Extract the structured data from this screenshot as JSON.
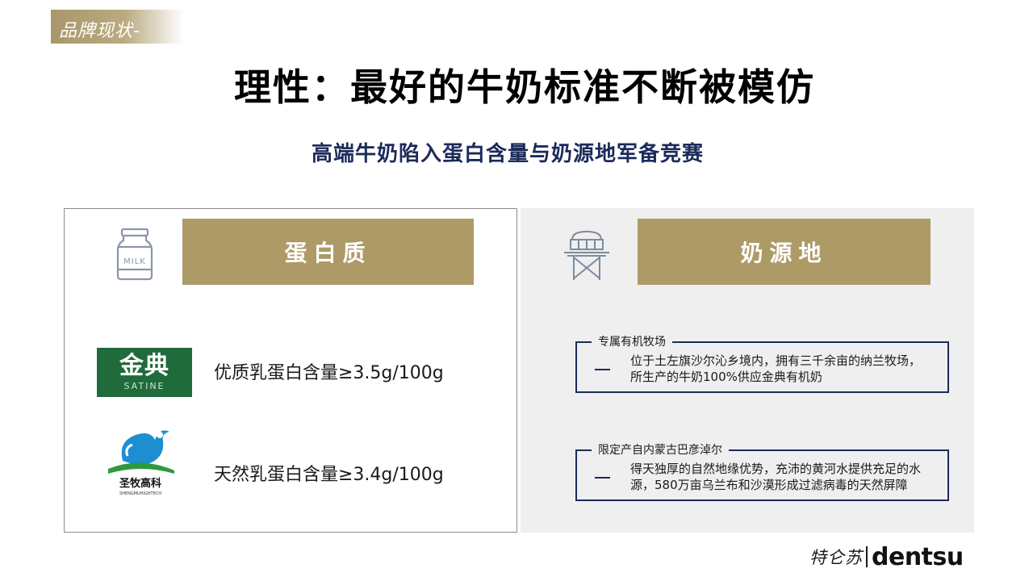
{
  "header": {
    "section_tag": "品牌现状-",
    "title": "理性：最好的牛奶标准不断被模仿",
    "subtitle": "高端牛奶陷入蛋白含量与奶源地军备竞赛"
  },
  "left_panel": {
    "icon_name": "milk-bottle-icon",
    "icon_text": "MILK",
    "header": "蛋白质",
    "brands": [
      {
        "logo_cn": "金典",
        "logo_en": "SATINE",
        "logo_color": "#1f6b3b",
        "text": "优质乳蛋白含量≥3.5g/100g"
      },
      {
        "logo_cn": "圣牧高科",
        "logo_en": "SHENGMUHIGHTECH",
        "text": "天然乳蛋白含量≥3.4g/100g"
      }
    ]
  },
  "right_panel": {
    "icon_name": "watchtower-icon",
    "header": "奶源地",
    "boxes": [
      {
        "label": "专属有机牧场",
        "text": "位于土左旗沙尔沁乡境内，拥有三千余亩的纳兰牧场，所生产的牛奶100%供应金典有机奶"
      },
      {
        "label": "限定产自内蒙古巴彦淖尔",
        "text": "得天独厚的自然地缘优势，充沛的黄河水提供充足的水源，580万亩乌兰布和沙漠形成过滤病毒的天然屏障"
      }
    ]
  },
  "footer": {
    "logo_left": "特仑苏",
    "logo_right": "dentsu"
  },
  "colors": {
    "gold": "#ad9a67",
    "navy": "#1c2a5a",
    "panel_gray": "#efefef"
  }
}
